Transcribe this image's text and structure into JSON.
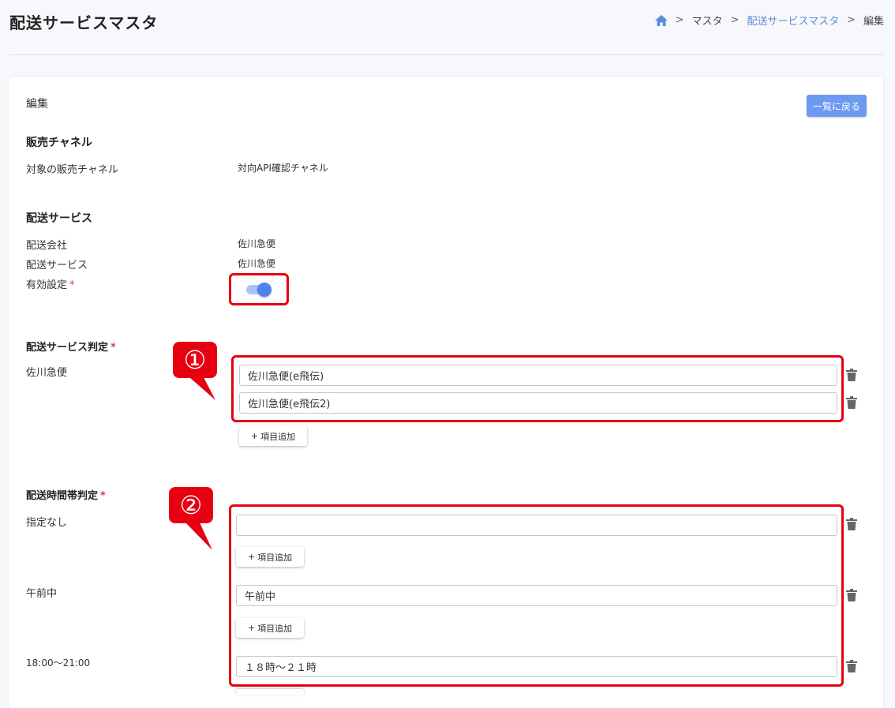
{
  "header": {
    "title": "配送サービスマスタ",
    "breadcrumb": {
      "home_icon": "home-icon",
      "sep": ">",
      "item1": "マスタ",
      "item2": "配送サービスマスタ",
      "current": "編集"
    }
  },
  "card": {
    "subtitle": "編集",
    "back_label": "一覧に戻る"
  },
  "sales_channel": {
    "title": "販売チャネル",
    "label": "対象の販売チャネル",
    "value": "対向API確認チャネル"
  },
  "delivery_service": {
    "title": "配送サービス",
    "company_label": "配送会社",
    "company_value": "佐川急便",
    "service_label": "配送サービス",
    "service_value": "佐川急便",
    "enabled_label": "有効設定",
    "required_mark": "*",
    "enabled": true
  },
  "service_judgement": {
    "title": "配送サービス判定",
    "required_mark": "*",
    "row_label": "佐川急便",
    "inputs": [
      "佐川急便(e飛伝)",
      "佐川急便(e飛伝2)"
    ],
    "add_label": "項目追加",
    "add_icon": "+"
  },
  "time_judgement": {
    "title": "配送時間帯判定",
    "required_mark": "*",
    "groups": [
      {
        "label": "指定なし",
        "input": ""
      },
      {
        "label": "午前中",
        "input": "午前中"
      },
      {
        "label": "18:00～21:00",
        "input": "１８時～２１時"
      }
    ],
    "add_label": "項目追加",
    "add_icon": "+"
  },
  "callouts": [
    "①",
    "②"
  ],
  "colors": {
    "accent": "#6d9af0",
    "highlight": "#e60012",
    "link": "#5b8ad6",
    "toggle": "#4d84eb"
  }
}
